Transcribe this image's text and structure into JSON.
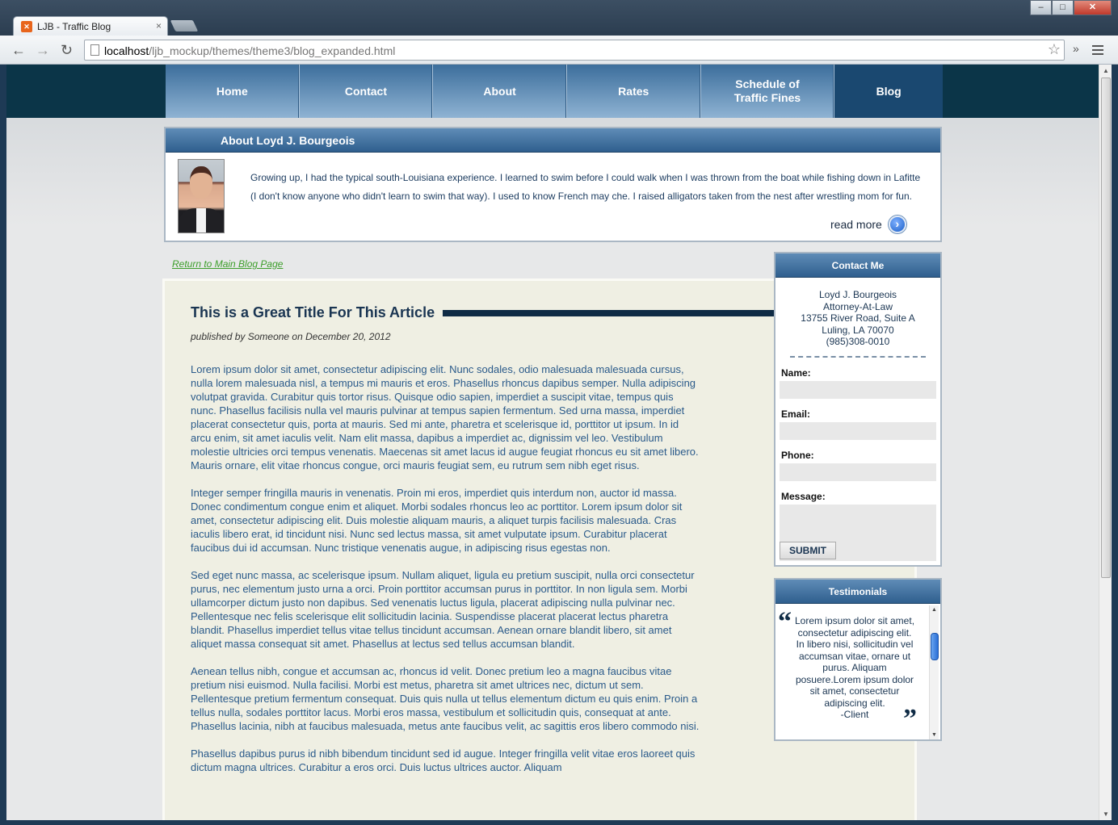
{
  "browser": {
    "tab_title": "LJB - Traffic Blog",
    "tab_close": "×",
    "url_host": "localhost",
    "url_path": "/ljb_mockup/themes/theme3/blog_expanded.html",
    "icons": [
      "back-icon",
      "forward-icon",
      "reload-icon",
      "star-icon",
      "menu-icon",
      "extensions-icon"
    ]
  },
  "nav": {
    "items": [
      {
        "label": "Home"
      },
      {
        "label": "Contact"
      },
      {
        "label": "About"
      },
      {
        "label": "Rates"
      },
      {
        "label": "Schedule of Traffic Fines"
      },
      {
        "label": "Blog",
        "active": true
      }
    ]
  },
  "about": {
    "title": "About Loyd J. Bourgeois",
    "text": "Growing up, I had the typical south-Louisiana experience.  I learned to swim before I could walk when I was thrown from the boat while fishing down in Lafitte (I don't know anyone who didn't learn to swim that way).  I used to know French may che.  I raised alligators taken from the nest after wrestling mom for fun.",
    "read_more": "read more"
  },
  "return_link": "Return to Main Blog Page",
  "article": {
    "title": "This is a Great Title For This Article",
    "meta": "published by Someone on December 20, 2012",
    "paragraphs": [
      "Lorem ipsum dolor sit amet, consectetur adipiscing elit. Nunc sodales, odio malesuada malesuada cursus, nulla lorem malesuada nisl, a tempus mi mauris et eros. Phasellus rhoncus dapibus semper. Nulla adipiscing volutpat gravida. Curabitur quis tortor risus. Quisque odio sapien, imperdiet a suscipit vitae, tempus quis nunc. Phasellus facilisis nulla vel mauris pulvinar at tempus sapien fermentum. Sed urna massa, imperdiet placerat consectetur quis, porta at mauris. Sed mi ante, pharetra et scelerisque id, porttitor ut ipsum. In id arcu enim, sit amet iaculis velit. Nam elit massa, dapibus a imperdiet ac, dignissim vel leo. Vestibulum molestie ultricies orci tempus venenatis. Maecenas sit amet lacus id augue feugiat rhoncus eu sit amet libero. Mauris ornare, elit vitae rhoncus congue, orci mauris feugiat sem, eu rutrum sem nibh eget risus.",
      "Integer semper fringilla mauris in venenatis. Proin mi eros, imperdiet quis interdum non, auctor id massa. Donec condimentum congue enim et aliquet. Morbi sodales rhoncus leo ac porttitor. Lorem ipsum dolor sit amet, consectetur adipiscing elit. Duis molestie aliquam mauris, a aliquet turpis facilisis malesuada. Cras iaculis libero erat, id tincidunt nisi. Nunc sed lectus massa, sit amet vulputate ipsum. Curabitur placerat faucibus dui id accumsan. Nunc tristique venenatis augue, in adipiscing risus egestas non.",
      "Sed eget nunc massa, ac scelerisque ipsum. Nullam aliquet, ligula eu pretium suscipit, nulla orci consectetur purus, nec elementum justo urna a orci. Proin porttitor accumsan purus in porttitor. In non ligula sem. Morbi ullamcorper dictum justo non dapibus. Sed venenatis luctus ligula, placerat adipiscing nulla pulvinar nec. Pellentesque nec felis scelerisque elit sollicitudin lacinia. Suspendisse placerat placerat lectus pharetra blandit. Phasellus imperdiet tellus vitae tellus tincidunt accumsan. Aenean ornare blandit libero, sit amet aliquet massa consequat sit amet. Phasellus at lectus sed tellus accumsan blandit.",
      "Aenean tellus nibh, congue et accumsan ac, rhoncus id velit. Donec pretium leo a magna faucibus vitae pretium nisi euismod. Nulla facilisi. Morbi est metus, pharetra sit amet ultrices nec, dictum ut sem. Pellentesque pretium fermentum consequat. Duis quis nulla ut tellus elementum dictum eu quis enim. Proin a tellus nulla, sodales porttitor lacus. Morbi eros massa, vestibulum et sollicitudin quis, consequat at ante. Phasellus lacinia, nibh at faucibus malesuada, metus ante faucibus velit, ac sagittis eros libero commodo nisi.",
      "Phasellus dapibus purus id nibh bibendum tincidunt sed id augue. Integer fringilla velit vitae eros laoreet quis dictum magna ultrices. Curabitur a eros orci. Duis luctus ultrices auctor. Aliquam"
    ]
  },
  "contact": {
    "title": "Contact Me",
    "address_lines": [
      "Loyd J. Bourgeois",
      "Attorney-At-Law",
      "13755 River Road, Suite A",
      "Luling, LA 70070",
      "(985)308-0010"
    ],
    "name_label": "Name:",
    "email_label": "Email:",
    "phone_label": "Phone:",
    "message_label": "Message:",
    "submit_label": "SUBMIT"
  },
  "testimonials": {
    "title": "Testimonials",
    "text": "Lorem ipsum dolor sit amet, consectetur adipiscing elit. In libero nisi, sollicitudin vel accumsan vitae, ornare ut purus. Aliquam posuere.Lorem ipsum dolor sit amet, consectetur adipiscing elit.",
    "author": "-Client",
    "quote_open": "“",
    "quote_close": "”"
  }
}
